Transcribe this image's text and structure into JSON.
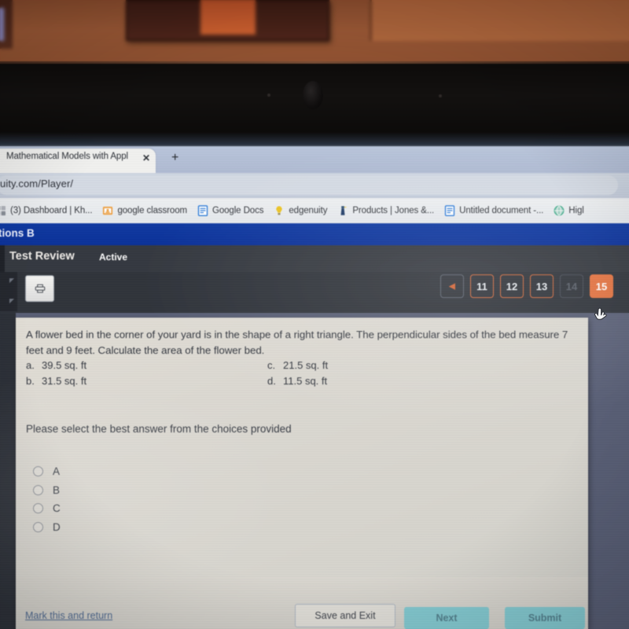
{
  "browser": {
    "tab": {
      "title": "Mathematical Models with Appli",
      "close_label": "✕",
      "new_tab_label": "+"
    },
    "url": "uity.com/Player/",
    "bookmarks": [
      {
        "label": "(3) Dashboard | Kh...",
        "icon": "dashboard-icon",
        "color": "#8a8f99"
      },
      {
        "label": "google classroom",
        "icon": "google-classroom-icon",
        "color": "#f2a03d"
      },
      {
        "label": "Google Docs",
        "icon": "google-docs-icon",
        "color": "#2b7de0"
      },
      {
        "label": "edgenuity",
        "icon": "lightbulb-icon",
        "color": "#f0c419"
      },
      {
        "label": "Products | Jones &...",
        "icon": "lighthouse-icon",
        "color": "#1f3d6b"
      },
      {
        "label": "Untitled document -...",
        "icon": "google-docs-icon",
        "color": "#2b7de0"
      },
      {
        "label": "Higl",
        "icon": "globe-icon",
        "color": "#3fae8c"
      }
    ]
  },
  "app": {
    "title": "tions B",
    "subtitle": "Test Review",
    "status": "Active",
    "print_label": "Print"
  },
  "pager": {
    "prev_label": "◀",
    "pages": [
      {
        "label": "11",
        "state": "available"
      },
      {
        "label": "12",
        "state": "available"
      },
      {
        "label": "13",
        "state": "available"
      },
      {
        "label": "14",
        "state": "disabled"
      },
      {
        "label": "15",
        "state": "current"
      }
    ],
    "accent_color": "#e8713c"
  },
  "question": {
    "text": "A flower bed in the corner of your yard is in the shape of a right triangle. The perpendicular sides of the bed measure 7 feet and 9 feet. Calculate the area of the flower bed.",
    "choices": [
      {
        "key": "a.",
        "text": "39.5 sq. ft"
      },
      {
        "key": "b.",
        "text": "31.5 sq. ft"
      },
      {
        "key": "c.",
        "text": "21.5 sq. ft"
      },
      {
        "key": "d.",
        "text": "11.5 sq. ft"
      }
    ],
    "prompt": "Please select the best answer from the choices provided",
    "options": [
      {
        "label": "A",
        "selected": false
      },
      {
        "label": "B",
        "selected": false
      },
      {
        "label": "C",
        "selected": false
      },
      {
        "label": "D",
        "selected": false
      }
    ]
  },
  "footer": {
    "mark_return": "Mark this and return",
    "save_exit": "Save and Exit",
    "next": "Next",
    "submit": "Submit"
  }
}
